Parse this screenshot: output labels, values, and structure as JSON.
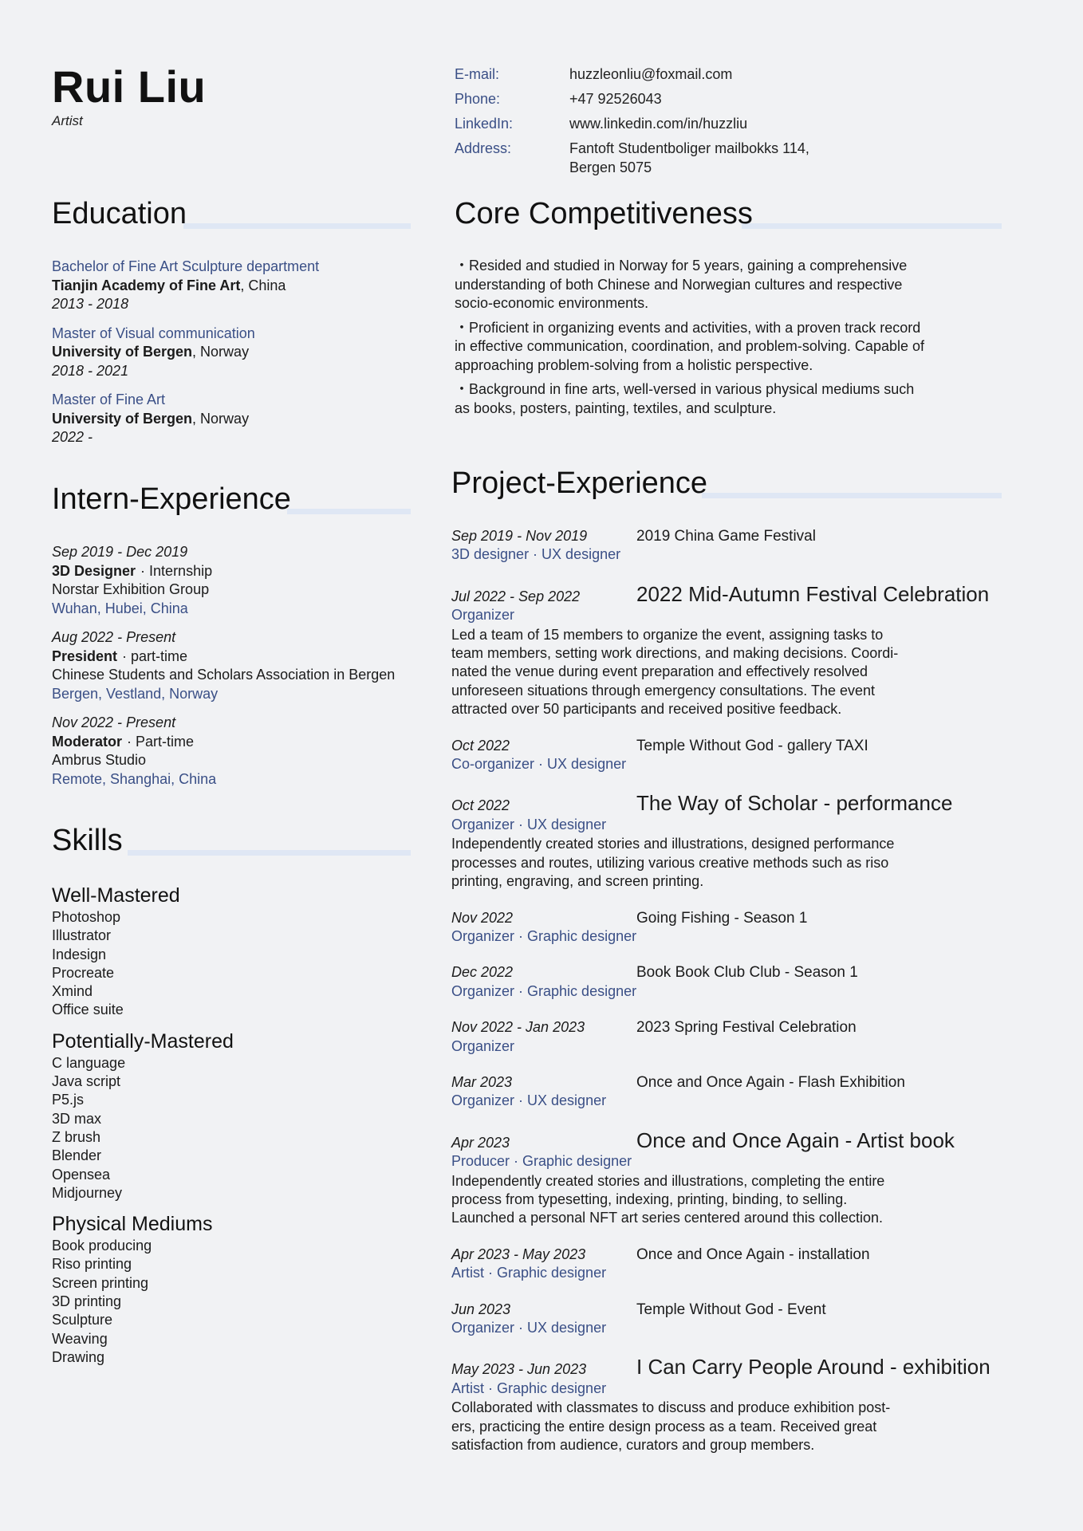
{
  "header": {
    "name": "Rui Liu",
    "role": "Artist"
  },
  "contact": [
    {
      "label": "E-mail:",
      "value": "huzzleonliu@foxmail.com"
    },
    {
      "label": "Phone:",
      "value": "+47 92526043"
    },
    {
      "label": "LinkedIn:",
      "value": "www.linkedin.com/in/huzzliu"
    },
    {
      "label": "Address:",
      "value": "Fantoft Studentboliger mailbokks 114,",
      "value2": "Bergen 5075"
    }
  ],
  "sections": {
    "education": "Education",
    "core": "Core Competitiveness",
    "intern": "Intern-Experience",
    "projects": "Project-Experience",
    "skills": "Skills"
  },
  "education": [
    {
      "degree": "Bachelor of Fine Art Sculpture department",
      "school": "Tianjin Academy of Fine Art",
      "country": ", China",
      "years": "2013 - 2018"
    },
    {
      "degree": "Master of Visual communication",
      "school": "University of Bergen",
      "country": ", Norway",
      "years": "2018 - 2021"
    },
    {
      "degree": "Master of Fine Art",
      "school": "University of Bergen",
      "country": ", Norway",
      "years": "2022 -"
    }
  ],
  "core": [
    "・Resided and studied in Norway for 5 years, gaining a comprehensive understanding of both Chinese and Norwegian cultures and respective socio-economic environments.",
    "・Proficient in organizing events and activities, with a proven track record in effective communication, coordination, and problem-solving. Capable of approaching problem-solving from a holistic perspective.",
    "・Background in fine arts, well-versed in various physical mediums such as books, posters, painting, textiles, and sculpture."
  ],
  "intern": [
    {
      "date": "Sep 2019 - Dec 2019",
      "role": "3D Designer",
      "type": "· Internship",
      "org": "Norstar Exhibition Group",
      "location": "Wuhan, Hubei, China"
    },
    {
      "date": "Aug 2022 - Present",
      "role": "President",
      "type": "· part-time",
      "org": "Chinese Students and Scholars Association in Bergen",
      "location": "Bergen, Vestland, Norway"
    },
    {
      "date": "Nov 2022 - Present",
      "role": "Moderator",
      "type": "· Part-time",
      "org": "Ambrus Studio",
      "location": "Remote, Shanghai, China"
    }
  ],
  "skills": [
    {
      "title": "Well-Mastered",
      "items": [
        "Photoshop",
        "Illustrator",
        "Indesign",
        "Procreate",
        "Xmind",
        "Office suite"
      ]
    },
    {
      "title": "Potentially-Mastered",
      "items": [
        "C language",
        "Java script",
        "P5.js",
        "3D max",
        "Z brush",
        "Blender",
        "Opensea",
        "Midjourney"
      ]
    },
    {
      "title": "Physical Mediums",
      "items": [
        "Book producing",
        "Riso printing",
        "Screen printing",
        "3D printing",
        "Sculpture",
        "Weaving",
        "Drawing"
      ]
    }
  ],
  "projects": [
    {
      "date": "Sep 2019 - Nov 2019",
      "title": "2019 China Game Festival",
      "big": false,
      "roles": "3D designer  · UX designer",
      "desc": ""
    },
    {
      "date": "Jul 2022 - Sep 2022",
      "title": "2022 Mid-Autumn Festival Celebration",
      "big": true,
      "roles": "Organizer",
      "desc": "Led a team of 15 members to organize the event, assigning tasks to team members, setting work directions, and making decisions. Coordi-nated the venue during event preparation and effectively resolved unforeseen situations through emergency consultations. The event attracted over 50 participants and received positive feedback."
    },
    {
      "date": "Oct 2022",
      "title": "Temple Without God - gallery TAXI",
      "big": false,
      "roles": "Co-organizer  · UX designer",
      "desc": ""
    },
    {
      "date": "Oct 2022",
      "title": "The Way of Scholar - performance",
      "big": true,
      "roles": "Organizer  · UX designer",
      "desc": "Independently created stories and illustrations, designed performance processes and routes, utilizing various creative methods such as riso printing, engraving, and screen printing."
    },
    {
      "date": "Nov 2022",
      "title": "Going Fishing - Season 1",
      "big": false,
      "roles": "Organizer  · Graphic designer",
      "desc": ""
    },
    {
      "date": "Dec 2022",
      "title": "Book Book Club Club - Season 1",
      "big": false,
      "roles": "Organizer  · Graphic designer",
      "desc": ""
    },
    {
      "date": "Nov 2022 - Jan 2023",
      "title": "2023 Spring Festival Celebration",
      "big": false,
      "roles": "Organizer",
      "desc": ""
    },
    {
      "date": "Mar 2023",
      "title": "Once and Once Again - Flash Exhibition",
      "big": false,
      "roles": "Organizer  · UX designer",
      "desc": ""
    },
    {
      "date": "Apr 2023",
      "title": "Once and Once Again - Artist book",
      "big": true,
      "roles": "Producer  · Graphic designer",
      "desc": "Independently created stories and illustrations, completing the entire process from typesetting, indexing, printing, binding, to selling. Launched a personal NFT art series centered around this collection."
    },
    {
      "date": "Apr 2023 - May 2023",
      "title": "Once and Once Again - installation",
      "big": false,
      "roles": "Artist  · Graphic designer",
      "desc": ""
    },
    {
      "date": "Jun 2023",
      "title": "Temple Without God - Event",
      "big": false,
      "roles": "Organizer  · UX designer",
      "desc": ""
    },
    {
      "date": "May 2023 - Jun 2023",
      "title": "I Can Carry People Around - exhibition",
      "big": true,
      "roles": "Artist  · Graphic designer",
      "desc": "Collaborated with classmates to discuss and produce exhibition post-ers, practicing the entire design process as a team. Received great satisfaction from audience, curators and group members."
    }
  ]
}
